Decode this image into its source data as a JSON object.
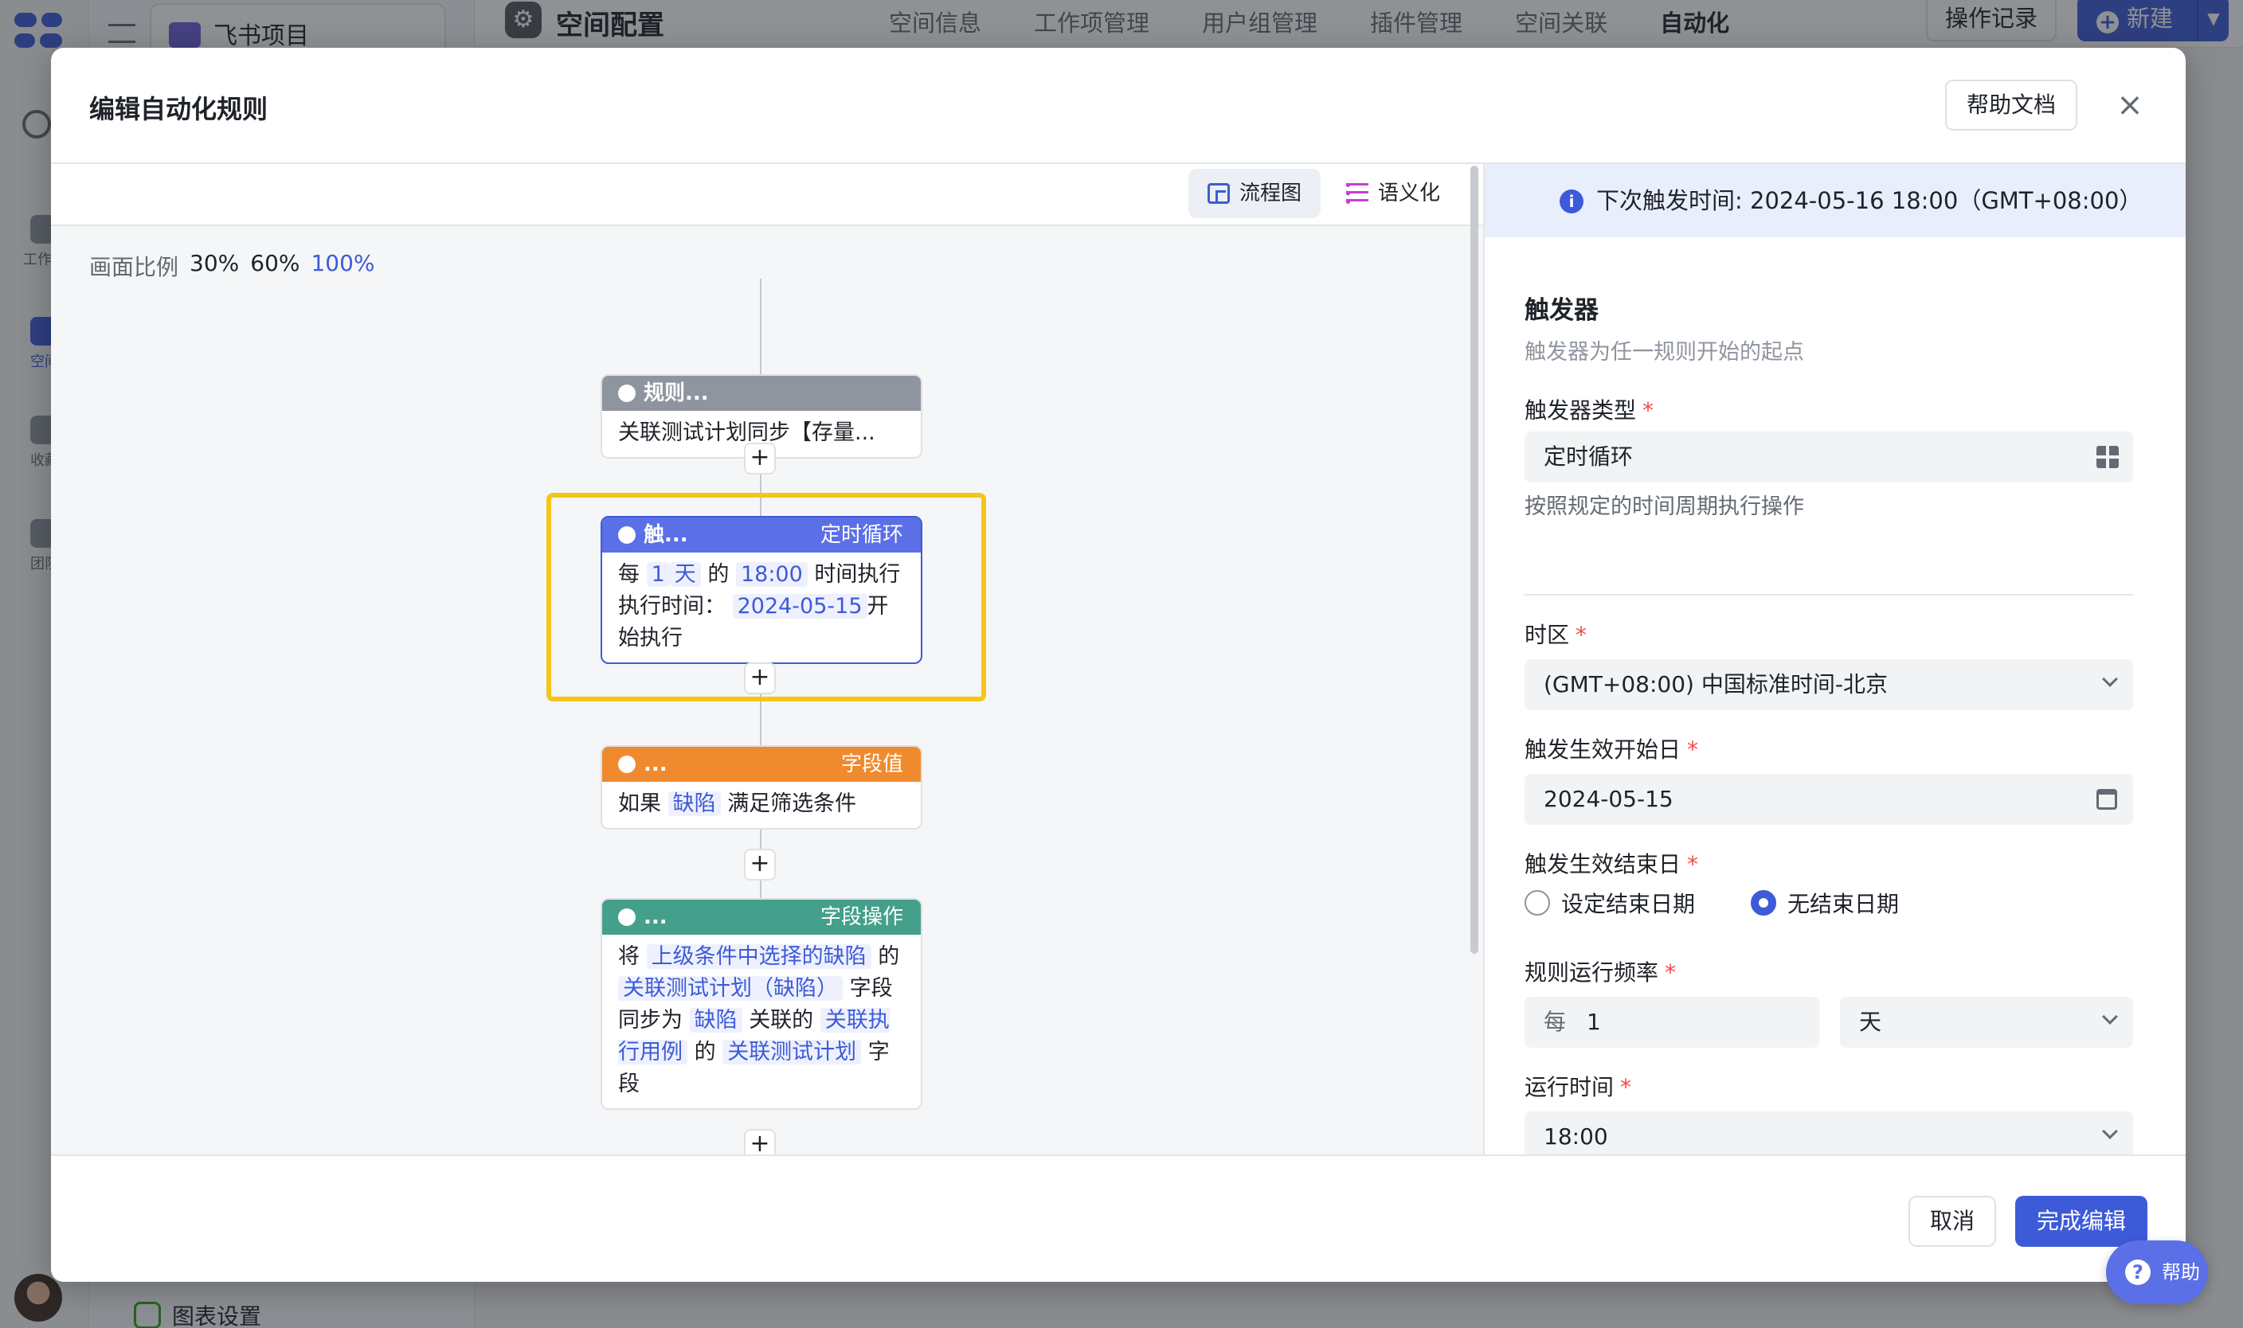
{
  "background": {
    "project_name": "飞书项目",
    "page_title": "空间配置",
    "tabs": [
      "空间信息",
      "工作项管理",
      "用户组管理",
      "插件管理",
      "空间关联",
      "自动化"
    ],
    "active_tab": "自动化",
    "log_button": "操作记录",
    "new_button": "新建",
    "rail": [
      "工作台",
      "空间",
      "收藏",
      "团队"
    ],
    "sidebar_bottom_item": "图表设置"
  },
  "modal": {
    "title": "编辑自动化规则",
    "help_doc": "帮助文档",
    "close": "×"
  },
  "canvas": {
    "view_flow": "流程图",
    "view_semantic": "语义化",
    "scale_label": "画面比例",
    "scale_options": [
      "30%",
      "60%",
      "100%"
    ],
    "scale_selected": "100%",
    "nodes": {
      "rule": {
        "head": "规则...",
        "body": "关联测试计划同步【存量..."
      },
      "trigger": {
        "head": "触...",
        "tag": "定时循环",
        "t1": "每",
        "every": "1",
        "unit": "天",
        "t2": "的",
        "time": "18:00",
        "t3": "时间执行",
        "t4": "执行时间：",
        "date": "2024-05-15",
        "t5": "开始执行"
      },
      "condition": {
        "head": "...",
        "tag": "字段值",
        "t1": "如果",
        "obj": "缺陷",
        "t2": "满足筛选条件"
      },
      "action": {
        "head": "...",
        "tag": "字段操作",
        "t1": "将",
        "a1": "上级条件中选择的缺陷",
        "t2": "的",
        "a2": "关联测试计划（缺陷）",
        "t3": "字段",
        "t4": "同步为",
        "a3": "缺陷",
        "t5": "关联的",
        "a4": "关联执行用例",
        "t6": "的",
        "a5": "关联测试计划",
        "t7": "字段"
      },
      "end": {
        "head": "..."
      }
    },
    "plus": "+"
  },
  "config": {
    "next_trigger": "下次触发时间: 2024-05-16 18:00（GMT+08:00）",
    "section_title": "触发器",
    "section_desc": "触发器为任一规则开始的起点",
    "trigger_type_label": "触发器类型",
    "trigger_type_value": "定时循环",
    "trigger_type_hint": "按照规定的时间周期执行操作",
    "timezone_label": "时区",
    "timezone_value": "(GMT+08:00) 中国标准时间-北京",
    "start_label": "触发生效开始日",
    "start_value": "2024-05-15",
    "end_label": "触发生效结束日",
    "end_opt_set": "设定结束日期",
    "end_opt_none": "无结束日期",
    "end_selected": "无结束日期",
    "freq_label": "规则运行频率",
    "freq_every": "每",
    "freq_value": "1",
    "freq_unit": "天",
    "time_label": "运行时间",
    "time_value": "18:00",
    "required_mark": "*"
  },
  "footer": {
    "cancel": "取消",
    "done": "完成编辑"
  },
  "help_float": "帮助",
  "colors": {
    "primary": "#3d5bd8",
    "trigger": "#5b6fe6",
    "condition": "#f08a2f",
    "action": "#44a08a",
    "rule": "#8f959e",
    "focus": "#f5c518"
  }
}
